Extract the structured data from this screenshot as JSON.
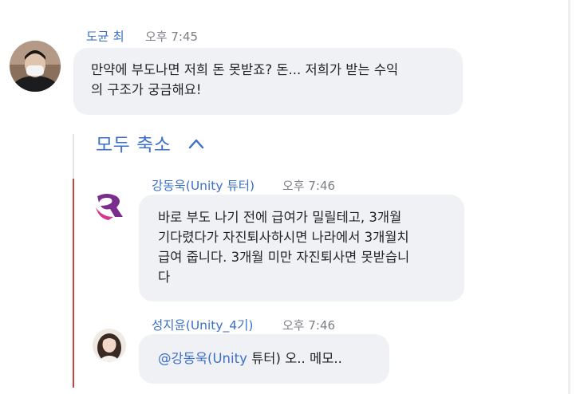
{
  "messages": [
    {
      "author": "도균 최",
      "time": "오후 7:45",
      "text": "만약에 부도나면 저희 돈 못받죠? 돈... 저희가 받는 수익의 구조가 궁금해요!",
      "lines": [
        "만약에 부도나면 저희 돈 못받죠? 돈... 저희가 받는 수익",
        "의 구조가 궁금해요!"
      ]
    }
  ],
  "thread": {
    "collapse_label": "모두 축소",
    "collapse_icon": "chevron-up-icon",
    "replies": [
      {
        "author": "강동욱(Unity 튜터)",
        "time": "오후 7:46",
        "avatar_icon": "unity-logo-icon",
        "lines": [
          "바로 부도 나기 전에 급여가 밀릴테고, 3개월",
          "기다렸다가 자진퇴사하시면 나라에서 3개월치",
          "급여 줍니다. 3개월 미만 자진퇴사면 못받습니",
          "다"
        ]
      },
      {
        "author": "성지윤(Unity_4기)",
        "time": "오후 7:46",
        "mention": "@강동욱(Unity",
        "rest": " 튜터) 오.. 메모.."
      }
    ]
  },
  "colors": {
    "accent": "#3b6fc9",
    "bubble": "#f0f1f4",
    "thread_line": "#c8423e"
  }
}
